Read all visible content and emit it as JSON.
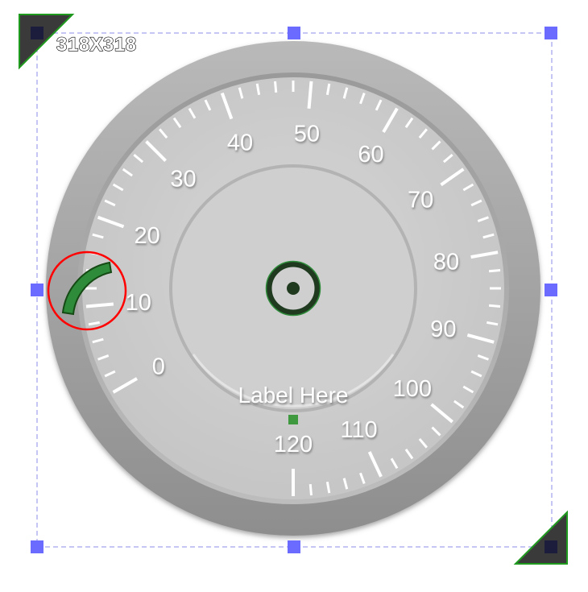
{
  "editor": {
    "size_label": "318X318",
    "selection_color": "#6b6bff",
    "corner_handle_color": "#3a3a3a",
    "corner_handle_border": "#1f9a1f"
  },
  "gauge": {
    "tick_labels": [
      "0",
      "10",
      "20",
      "30",
      "40",
      "50",
      "60",
      "70",
      "80",
      "90",
      "100",
      "110",
      "120"
    ],
    "min": 0,
    "max": 120,
    "center_label": "Label Here",
    "face_color": "#cdcdcd",
    "bezel_color": "#a6a6a6",
    "needle_marker_color": "#2e8b3a",
    "selection_marker_color": "#ff0000"
  }
}
